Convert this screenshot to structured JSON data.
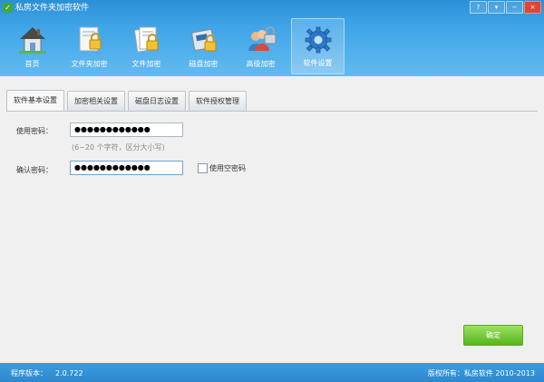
{
  "window": {
    "title": "私房文件夹加密软件",
    "controls": [
      "?",
      "▾",
      "−",
      "×"
    ]
  },
  "toolbar": {
    "items": [
      {
        "label": "首页",
        "icon": "home-icon"
      },
      {
        "label": "文件夹加密",
        "icon": "folder-lock-icon"
      },
      {
        "label": "文件加密",
        "icon": "file-lock-icon"
      },
      {
        "label": "磁盘加密",
        "icon": "disk-lock-icon"
      },
      {
        "label": "高级加密",
        "icon": "users-lock-icon"
      },
      {
        "label": "软件设置",
        "icon": "gear-icon",
        "active": true
      }
    ]
  },
  "tabs": [
    {
      "label": "软件基本设置",
      "active": true
    },
    {
      "label": "加密相关设置"
    },
    {
      "label": "磁盘日志设置"
    },
    {
      "label": "软件授权管理"
    }
  ],
  "form": {
    "password_label": "使用密码：",
    "password_value": "●●●●●●●●●●●●",
    "hint": "(6~20 个字符，区分大小写)",
    "confirm_label": "确认密码：",
    "confirm_value": "●●●●●●●●●●●●",
    "empty_password_label": "使用空密码",
    "empty_password_checked": false
  },
  "buttons": {
    "ok": "确定"
  },
  "status": {
    "version_label": "程序版本：",
    "version": "2.0.722",
    "copyright": "版权所有：私房软件 2010-2013"
  },
  "colors": {
    "title_blue": "#2b8fd6",
    "status_blue": "#3a9ee2",
    "ok_green": "#57b41f",
    "logo_green": "#3ea93a"
  }
}
